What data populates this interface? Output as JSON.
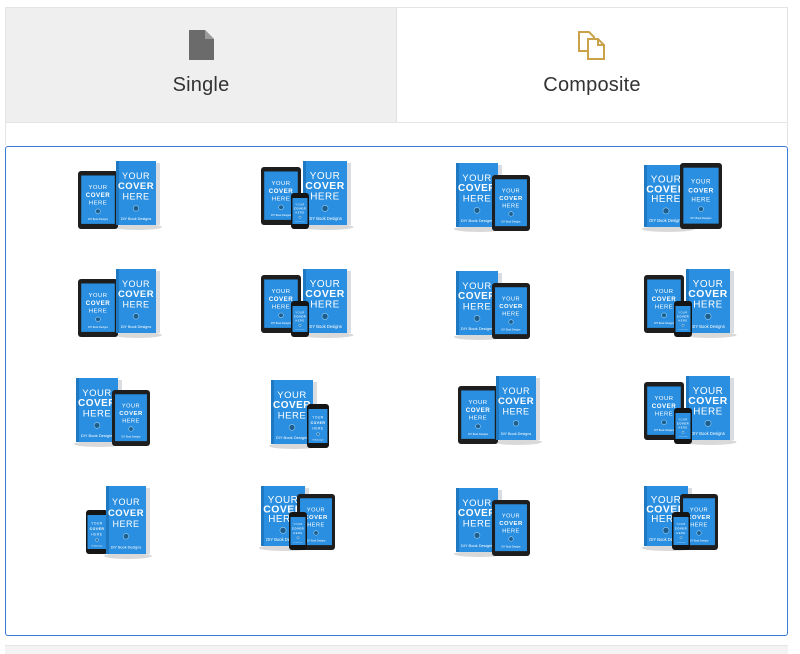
{
  "tabs": {
    "single": {
      "label": "Single",
      "icon": "document-icon",
      "active": true
    },
    "composite": {
      "label": "Composite",
      "icon": "documents-stack-icon",
      "accent": "#c9a24a"
    }
  },
  "cover": {
    "line1": "YOUR",
    "line2": "COVER",
    "line3": "HERE",
    "brand": "DIY Book Designs",
    "color": "#2a8fe0"
  },
  "mockups": [
    {
      "name": "tablet-and-book",
      "layout": "tablet-book"
    },
    {
      "name": "tablet-phone-and-book",
      "layout": "tablet-phone-book"
    },
    {
      "name": "book-and-ereader",
      "layout": "book-ereader"
    },
    {
      "name": "book-and-large-tablet",
      "layout": "book-bigtablet"
    },
    {
      "name": "ereader-and-book",
      "layout": "tablet-book"
    },
    {
      "name": "tablet-phone-book-2",
      "layout": "tablet-phone-book"
    },
    {
      "name": "book-and-ereader-2",
      "layout": "book-ereader"
    },
    {
      "name": "tablet-phone-book-3",
      "layout": "tablet-phone-book"
    },
    {
      "name": "book-and-ereader-front",
      "layout": "book-ereader"
    },
    {
      "name": "book-and-phone",
      "layout": "book-phone"
    },
    {
      "name": "tablet-and-book-2",
      "layout": "tablet-book"
    },
    {
      "name": "tablet-phone-book-4",
      "layout": "tablet-phone-book"
    },
    {
      "name": "phone-and-book",
      "layout": "phone-book"
    },
    {
      "name": "book-phone-tablet",
      "layout": "book-phone-tablet"
    },
    {
      "name": "book-and-tablet",
      "layout": "book-ereader"
    },
    {
      "name": "book-phone-tablet-2",
      "layout": "book-phone-tablet"
    }
  ]
}
